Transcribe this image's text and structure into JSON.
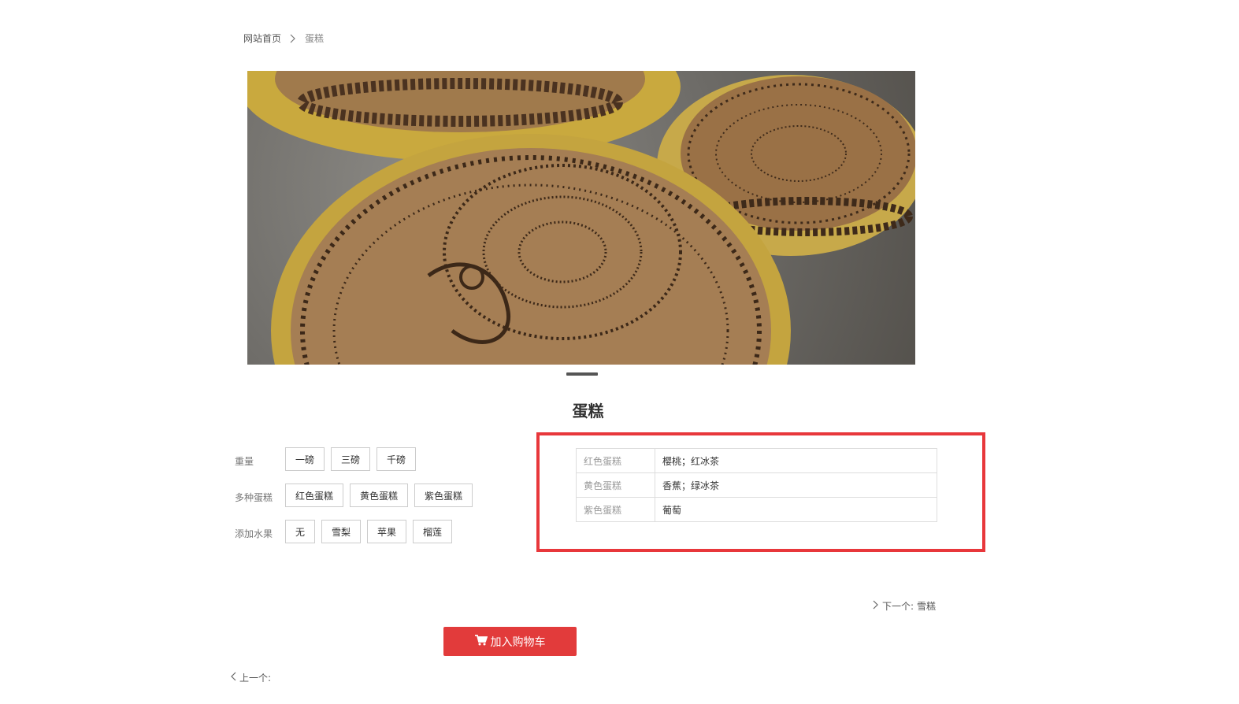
{
  "breadcrumb": {
    "home": "网站首页",
    "current": "蛋糕"
  },
  "product": {
    "title": "蛋糕"
  },
  "options": [
    {
      "label": "重量",
      "values": [
        "一磅",
        "三磅",
        "千磅"
      ]
    },
    {
      "label": "多种蛋糕",
      "values": [
        "红色蛋糕",
        "黄色蛋糕",
        "紫色蛋糕"
      ]
    },
    {
      "label": "添加水果",
      "values": [
        "无",
        "雪梨",
        "苹果",
        "榴莲"
      ]
    }
  ],
  "specs": [
    {
      "key": "红色蛋糕",
      "value": "樱桃；红冰茶"
    },
    {
      "key": "黄色蛋糕",
      "value": "香蕉；绿冰茶"
    },
    {
      "key": "紫色蛋糕",
      "value": "葡萄"
    }
  ],
  "nav": {
    "next_label": "下一个:",
    "next_title": "雪糕",
    "prev_label": "上一个:"
  },
  "cart": {
    "label": "加入购物车"
  },
  "colors": {
    "accent": "#e23b3b",
    "highlight_border": "#e8373b"
  }
}
